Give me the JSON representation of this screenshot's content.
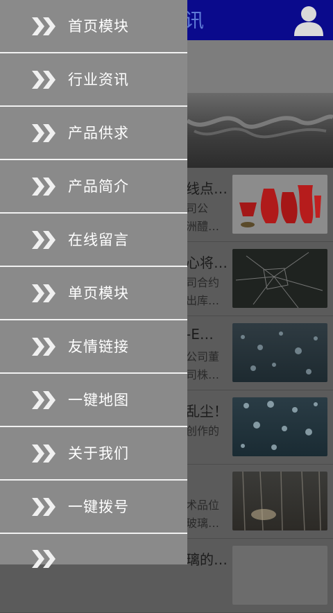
{
  "app": {
    "title_fragment": "讯",
    "list_rows": [
      {
        "title": "线点…",
        "desc": "司公\n洲醴…"
      },
      {
        "title": "心将…",
        "desc": "司合约\n出库…"
      },
      {
        "title": "-E…",
        "desc": "公司董\n司株…"
      },
      {
        "title": "乱尘！",
        "desc": "创作的"
      },
      {
        "title": "",
        "desc": "术品位\n玻璃…"
      },
      {
        "title": "璃的…",
        "desc": ""
      }
    ]
  },
  "drawer": {
    "items": [
      {
        "label": "首页模块"
      },
      {
        "label": "行业资讯"
      },
      {
        "label": "产品供求"
      },
      {
        "label": "产品简介"
      },
      {
        "label": "在线留言"
      },
      {
        "label": "单页模块"
      },
      {
        "label": "友情链接"
      },
      {
        "label": "一键地图"
      },
      {
        "label": "关于我们"
      },
      {
        "label": "一键拨号"
      }
    ]
  },
  "colors": {
    "topbar": "#0a0a8c",
    "drawer_bg": "#8a8a8a",
    "drawer_divider": "#f2f2f2",
    "menu_text": "#ffffff"
  }
}
